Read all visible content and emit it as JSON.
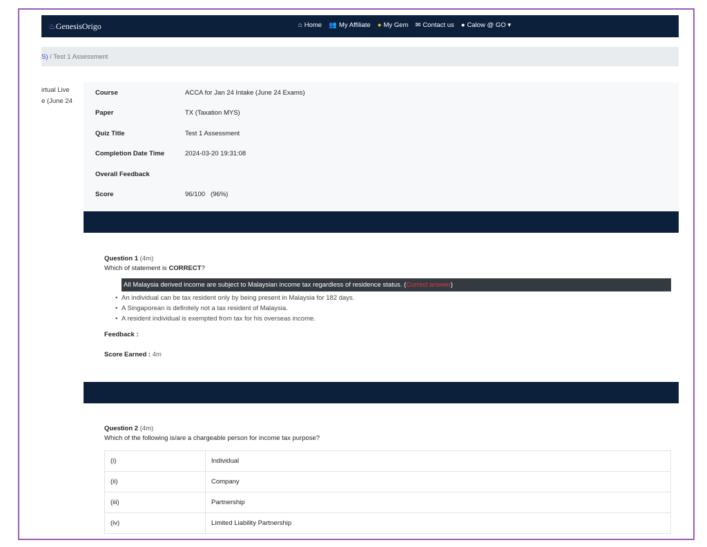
{
  "nav": {
    "brand": "GenesisOrigo",
    "items": [
      {
        "icon": "home-icon",
        "label": "Home"
      },
      {
        "icon": "users-icon",
        "label": "My Affiliate"
      },
      {
        "icon": "coins-icon",
        "label": "My Gem"
      },
      {
        "icon": "envelope-icon",
        "label": "Contact us"
      },
      {
        "icon": "user-circle-icon",
        "label": "Calow @ GO"
      }
    ]
  },
  "breadcrumb": {
    "prev": "S)",
    "sep": "/",
    "current": "Test 1 Assessment"
  },
  "sidebar": {
    "line1": "irtual Live",
    "line2": "e (June 24"
  },
  "info": [
    {
      "k": "Course",
      "v": "ACCA for Jan 24 Intake (June 24 Exams)"
    },
    {
      "k": "Paper",
      "v": "TX (Taxation MYS)"
    },
    {
      "k": "Quiz Title",
      "v": "Test 1 Assessment"
    },
    {
      "k": "Completion Date Time",
      "v": "2024-03-20 19:31:08"
    },
    {
      "k": "Overall Feedback",
      "v": ""
    },
    {
      "k": "Score",
      "v": "96/100   (96%)"
    }
  ],
  "q1": {
    "label": "Question 1",
    "marks": "(4m)",
    "text_pre": "Which of statement is ",
    "text_bold": "CORRECT",
    "text_post": "?",
    "correct": "All Malaysia derived income are subject to Malaysian income tax regardless of residence status. (",
    "correct_tag": "Correct answer",
    "correct_close": ")",
    "options": [
      "An individual can be tax resident only by being present in Malaysia for 182 days.",
      "A Singaporean is definitely not a tax resident of Malaysia.",
      "A resident individual is exempted from tax for his overseas income."
    ],
    "feedback_label": "Feedback :",
    "score_label": "Score Earned :",
    "score": "4m"
  },
  "q2": {
    "label": "Question 2",
    "marks": "(4m)",
    "text": "Which of the following is/are a chargeable person for income tax purpose?",
    "rows": [
      [
        "(i)",
        "Individual"
      ],
      [
        "(ii)",
        "Company"
      ],
      [
        "(iii)",
        "Partnership"
      ],
      [
        "(iv)",
        "Limited Liability Partnership"
      ]
    ]
  },
  "colors": {
    "navbar": "#0c1f3b",
    "frame": "#9b59b6",
    "correct_tag": "#e23b3b"
  }
}
